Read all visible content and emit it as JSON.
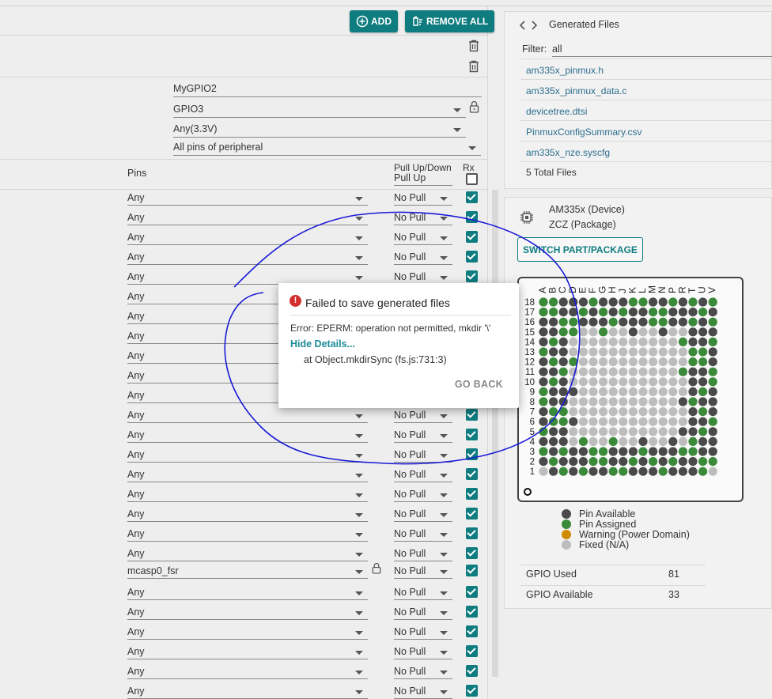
{
  "toolbar": {
    "add_label": "ADD",
    "remove_all_label": "REMOVE ALL"
  },
  "config": {
    "name": "MyGPIO2",
    "peripheral": "GPIO3",
    "voltage": "Any(3.3V)",
    "pins_mode": "All pins of peripheral"
  },
  "table": {
    "pins_header": "Pins",
    "pull_header": "Pull Up/Down",
    "pull_header_value": "Pull Up",
    "rx_header": "Rx",
    "rows": [
      {
        "pin": "Any",
        "pull": "No Pull"
      },
      {
        "pin": "Any",
        "pull": "No Pull"
      },
      {
        "pin": "Any",
        "pull": "No Pull"
      },
      {
        "pin": "Any",
        "pull": "No Pull"
      },
      {
        "pin": "Any",
        "pull": "No Pull"
      },
      {
        "pin": "Any",
        "pull": ""
      },
      {
        "pin": "Any",
        "pull": ""
      },
      {
        "pin": "Any",
        "pull": ""
      },
      {
        "pin": "Any",
        "pull": ""
      },
      {
        "pin": "Any",
        "pull": ""
      },
      {
        "pin": "Any",
        "pull": ""
      },
      {
        "pin": "Any",
        "pull": "No Pull"
      },
      {
        "pin": "Any",
        "pull": "No Pull"
      },
      {
        "pin": "Any",
        "pull": "No Pull"
      },
      {
        "pin": "Any",
        "pull": "No Pull"
      },
      {
        "pin": "Any",
        "pull": "No Pull"
      },
      {
        "pin": "Any",
        "pull": "No Pull"
      },
      {
        "pin": "Any",
        "pull": "No Pull"
      },
      {
        "pin": "Any",
        "pull": "No Pull"
      },
      {
        "pin": "mcasp0_fsr",
        "pull": "No Pull"
      },
      {
        "pin": "Any",
        "pull": "No Pull"
      },
      {
        "pin": "Any",
        "pull": "No Pull"
      },
      {
        "pin": "Any",
        "pull": "No Pull"
      },
      {
        "pin": "Any",
        "pull": "No Pull"
      },
      {
        "pin": "Any",
        "pull": "No Pull"
      },
      {
        "pin": "Any",
        "pull": "No Pull"
      }
    ]
  },
  "files": {
    "title": "Generated Files",
    "filter_label": "Filter:",
    "filter_value": "all",
    "items": [
      "am335x_pinmux.h",
      "am335x_pinmux_data.c",
      "devicetree.dtsi",
      "PinmuxConfigSummary.csv",
      "am335x_nze.syscfg"
    ],
    "total": "5 Total Files"
  },
  "device": {
    "device": "AM335x (Device)",
    "package": "ZCZ (Package)",
    "switch_label": "SWITCH PART/PACKAGE",
    "columns": [
      "A",
      "B",
      "C",
      "D",
      "E",
      "F",
      "G",
      "H",
      "J",
      "K",
      "L",
      "M",
      "N",
      "P",
      "R",
      "T",
      "U",
      "V"
    ],
    "rows": [
      "18",
      "17",
      "16",
      "15",
      "14",
      "13",
      "12",
      "11",
      "10",
      "9",
      "8",
      "7",
      "6",
      "5",
      "4",
      "3",
      "2",
      "1"
    ],
    "colors": {
      "available": "#4a4a4a",
      "assigned": "#3a8a3a",
      "warning": "#d08a00",
      "fixed": "#bdbdbd"
    },
    "legend": [
      "Pin Available",
      "Pin Assigned",
      "Warning (Power Domain)",
      "Fixed (N/A)"
    ]
  },
  "stats": {
    "gpio_used_label": "GPIO Used",
    "gpio_used": "81",
    "gpio_available_label": "GPIO Available",
    "gpio_available": "33"
  },
  "dialog": {
    "title": "Failed to save generated files",
    "message": "Error: EPERM: operation not permitted, mkdir '\\'",
    "details_label": "Hide Details...",
    "stack": "at Object.mkdirSync (fs.js:731:3)",
    "go_back": "GO BACK"
  }
}
